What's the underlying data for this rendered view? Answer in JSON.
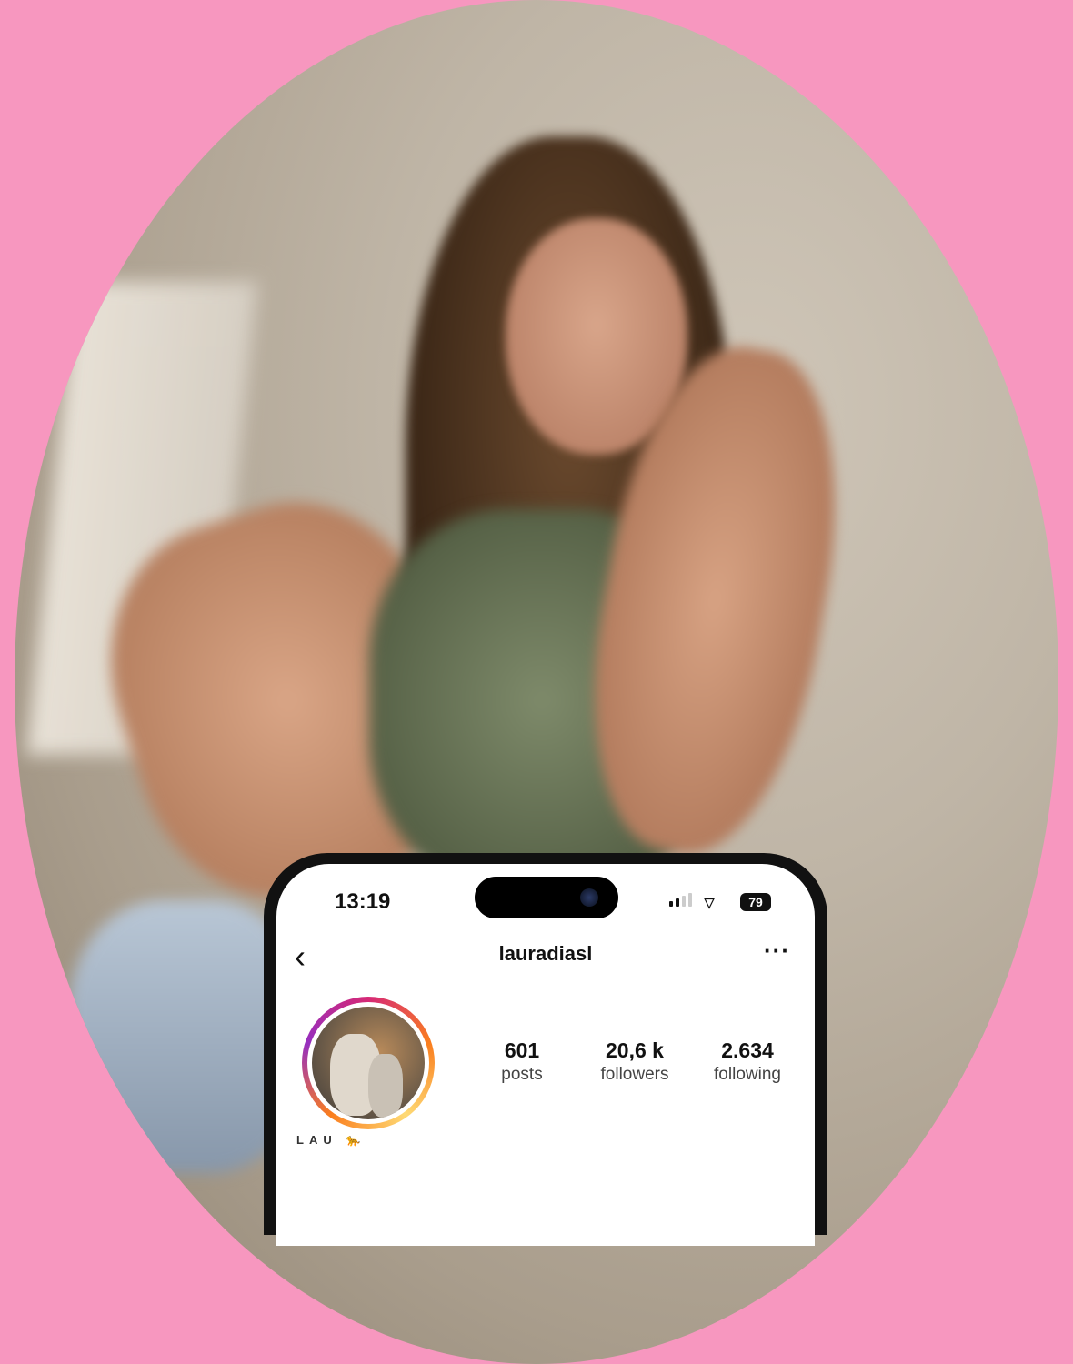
{
  "status_bar": {
    "time": "13:19",
    "battery": "79",
    "wifi_icon": "wifi-icon",
    "signal_icon": "signal-icon"
  },
  "header": {
    "back_icon": "chevron-left-icon",
    "username": "lauradiasl",
    "more_icon": "more-horizontal-icon"
  },
  "profile": {
    "stats": [
      {
        "value": "601",
        "label": "posts"
      },
      {
        "value": "20,6 k",
        "label": "followers"
      },
      {
        "value": "2.634",
        "label": "following"
      }
    ],
    "name": "LAU 🐆"
  },
  "colors": {
    "background": "#f797bf",
    "story_ring": [
      "#d62976",
      "#fa7e1e",
      "#feda75",
      "#962fbf"
    ]
  }
}
